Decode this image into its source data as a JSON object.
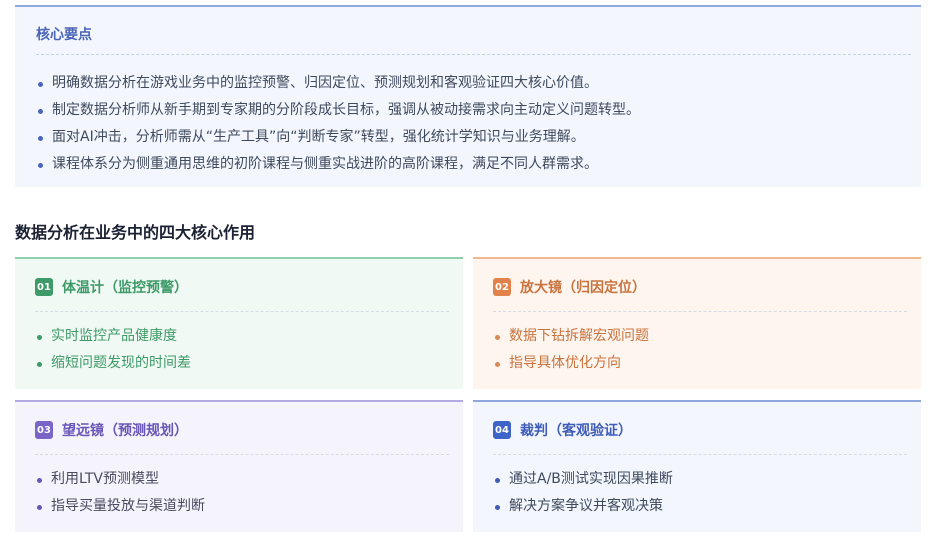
{
  "summary": {
    "title": "核心要点",
    "items": [
      "明确数据分析在游戏业务中的监控预警、归因定位、预测规划和客观验证四大核心价值。",
      "制定数据分析师从新手期到专家期的分阶段成长目标，强调从被动接需求向主动定义问题转型。",
      "面对AI冲击，分析师需从“生产工具”向“判断专家”转型，强化统计学知识与业务理解。",
      "课程体系分为侧重通用思维的初阶课程与侧重实战进阶的高阶课程，满足不同人群需求。"
    ]
  },
  "section": {
    "title": "数据分析在业务中的四大核心作用"
  },
  "cards": [
    {
      "badge": "01",
      "title": "体温计（监控预警）",
      "items": [
        "实时监控产品健康度",
        "缩短问题发现的时间差"
      ]
    },
    {
      "badge": "02",
      "title": "放大镜（归因定位）",
      "items": [
        "数据下钻拆解宏观问题",
        "指导具体优化方向"
      ]
    },
    {
      "badge": "03",
      "title": "望远镜（预测规划）",
      "items": [
        "利用LTV预测模型",
        "指导买量投放与渠道判断"
      ]
    },
    {
      "badge": "04",
      "title": "裁判（客观验证）",
      "items": [
        "通过A/B测试实现因果推断",
        "解决方案争议并客观决策"
      ]
    }
  ],
  "colors": {
    "card1_accent": "#3e9a68",
    "card2_accent": "#e0824a",
    "card3_accent": "#7a64c8",
    "card4_accent": "#3f64c8",
    "summary_accent": "#4a64b8"
  }
}
